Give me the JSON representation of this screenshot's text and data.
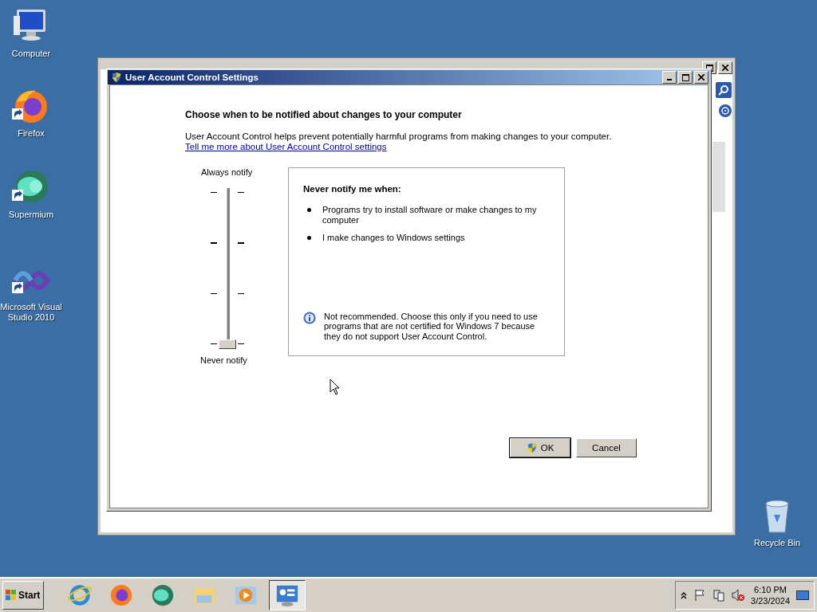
{
  "desktop_icons": [
    {
      "label": "Computer",
      "kind": "computer",
      "shortcut": false
    },
    {
      "label": "Firefox",
      "kind": "firefox",
      "shortcut": true
    },
    {
      "label": "Supermium",
      "kind": "supermium",
      "shortcut": true
    },
    {
      "label": "Microsoft Visual Studio 2010",
      "kind": "visual-studio",
      "shortcut": true
    },
    {
      "label": "Recycle Bin",
      "kind": "recycle-bin",
      "shortcut": false
    }
  ],
  "dialog": {
    "title": "User Account Control Settings",
    "heading": "Choose when to be notified about changes to your computer",
    "description": "User Account Control helps prevent potentially harmful programs from making changes to your computer.",
    "link": "Tell me more about User Account Control settings",
    "slider": {
      "top_label": "Always notify",
      "bottom_label": "Never notify",
      "level": 0
    },
    "info_panel": {
      "heading": "Never notify me when:",
      "bullets": [
        "Programs try to install software or make changes to my computer",
        "I make changes to Windows settings"
      ],
      "note": "Not recommended. Choose this only if you need to use programs that are not certified for Windows 7 because they do not support User Account Control."
    },
    "buttons": [
      {
        "label": "OK",
        "default": true
      },
      {
        "label": "Cancel",
        "default": false
      }
    ]
  },
  "taskbar": {
    "start": "Start",
    "apps": [
      {
        "kind": "ie",
        "selected": false
      },
      {
        "kind": "firefox",
        "selected": false
      },
      {
        "kind": "supermium",
        "selected": false
      },
      {
        "kind": "explorer",
        "selected": false
      },
      {
        "kind": "media",
        "selected": false
      },
      {
        "kind": "control-panel",
        "selected": true
      }
    ],
    "time": "6:10 PM",
    "date": "3/23/2024"
  }
}
